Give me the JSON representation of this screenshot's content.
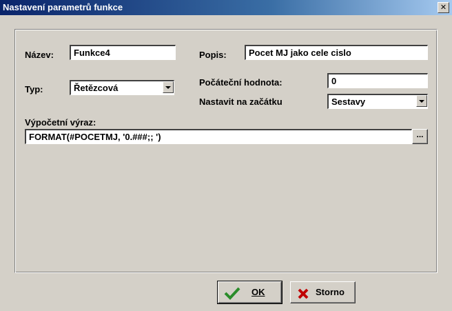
{
  "window": {
    "title": "Nastavení parametrů funkce",
    "close": "✕"
  },
  "form": {
    "nazev_label": "Název:",
    "nazev_value": "Funkce4",
    "popis_label": "Popis:",
    "popis_value": "Pocet MJ jako cele cislo",
    "typ_label": "Typ:",
    "typ_value": "Řetězcová",
    "pocatecni_label": "Počáteční hodnota:",
    "pocatecni_value": "0",
    "nastavit_label": "Nastavit na začátku",
    "nastavit_value": "Sestavy",
    "vyraz_label": "Výpočetní výraz:",
    "vyraz_value": "FORMAT(#POCETMJ, '0.###;; ')",
    "ellipsis": "..."
  },
  "buttons": {
    "ok": "OK",
    "storno": "Storno"
  },
  "icons": {
    "ok": "check-icon",
    "storno": "x-icon"
  },
  "colors": {
    "title_start": "#0a246a",
    "title_end": "#a6caf0",
    "check": "#2a8c2a",
    "cross": "#c00000"
  }
}
